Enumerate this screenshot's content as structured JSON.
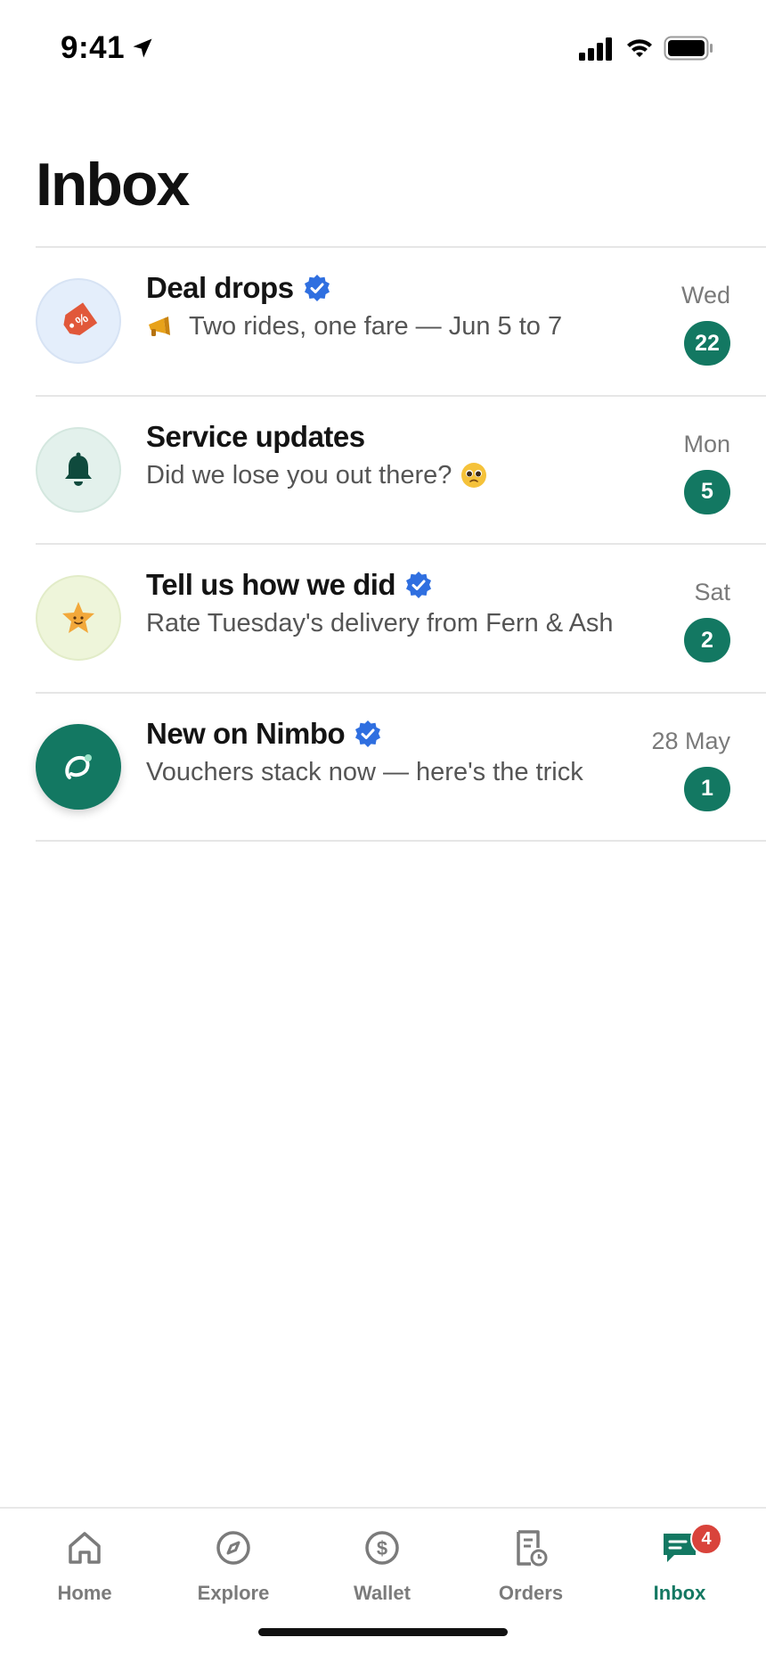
{
  "status_bar": {
    "time": "9:41",
    "icons": [
      "location-arrow-icon",
      "cellular-signal-icon",
      "wifi-icon",
      "battery-icon"
    ]
  },
  "page": {
    "title": "Inbox"
  },
  "threads": [
    {
      "title": "Deal drops",
      "verified": true,
      "preview": "Two rides, one fare — Jun 5 to 7",
      "preview_emoji": "megaphone",
      "date": "Wed",
      "unread": "22",
      "avatar_icon": "price-tag-icon",
      "avatar_bg": "#e4eefb"
    },
    {
      "title": "Service updates",
      "verified": false,
      "preview": "Did we lose you out there?",
      "preview_emoji_after": "pleading-face",
      "date": "Mon",
      "unread": "5",
      "avatar_icon": "bell-icon",
      "avatar_bg": "#e3f1ec"
    },
    {
      "title": "Tell us how we did",
      "verified": true,
      "preview": "Rate Tuesday's delivery from Fern & Ash",
      "date": "Sat",
      "unread": "2",
      "avatar_icon": "smiling-star-icon",
      "avatar_bg": "#eef5da"
    },
    {
      "title": "New on Nimbo",
      "verified": true,
      "preview": "Vouchers stack now — here's the trick",
      "date": "28 May",
      "unread": "1",
      "avatar_icon": "nimbo-logo-icon",
      "avatar_bg": "#137862"
    }
  ],
  "tab_bar": {
    "tabs": [
      {
        "label": "Home",
        "icon": "home-icon"
      },
      {
        "label": "Explore",
        "icon": "compass-icon"
      },
      {
        "label": "Wallet",
        "icon": "dollar-circle-icon"
      },
      {
        "label": "Orders",
        "icon": "receipt-clock-icon"
      },
      {
        "label": "Inbox",
        "icon": "chat-bubble-icon",
        "active": true,
        "badge": "4"
      }
    ]
  },
  "colors": {
    "accent": "#137862",
    "verified": "#2f6fe0",
    "tab_badge": "#d9433b"
  }
}
